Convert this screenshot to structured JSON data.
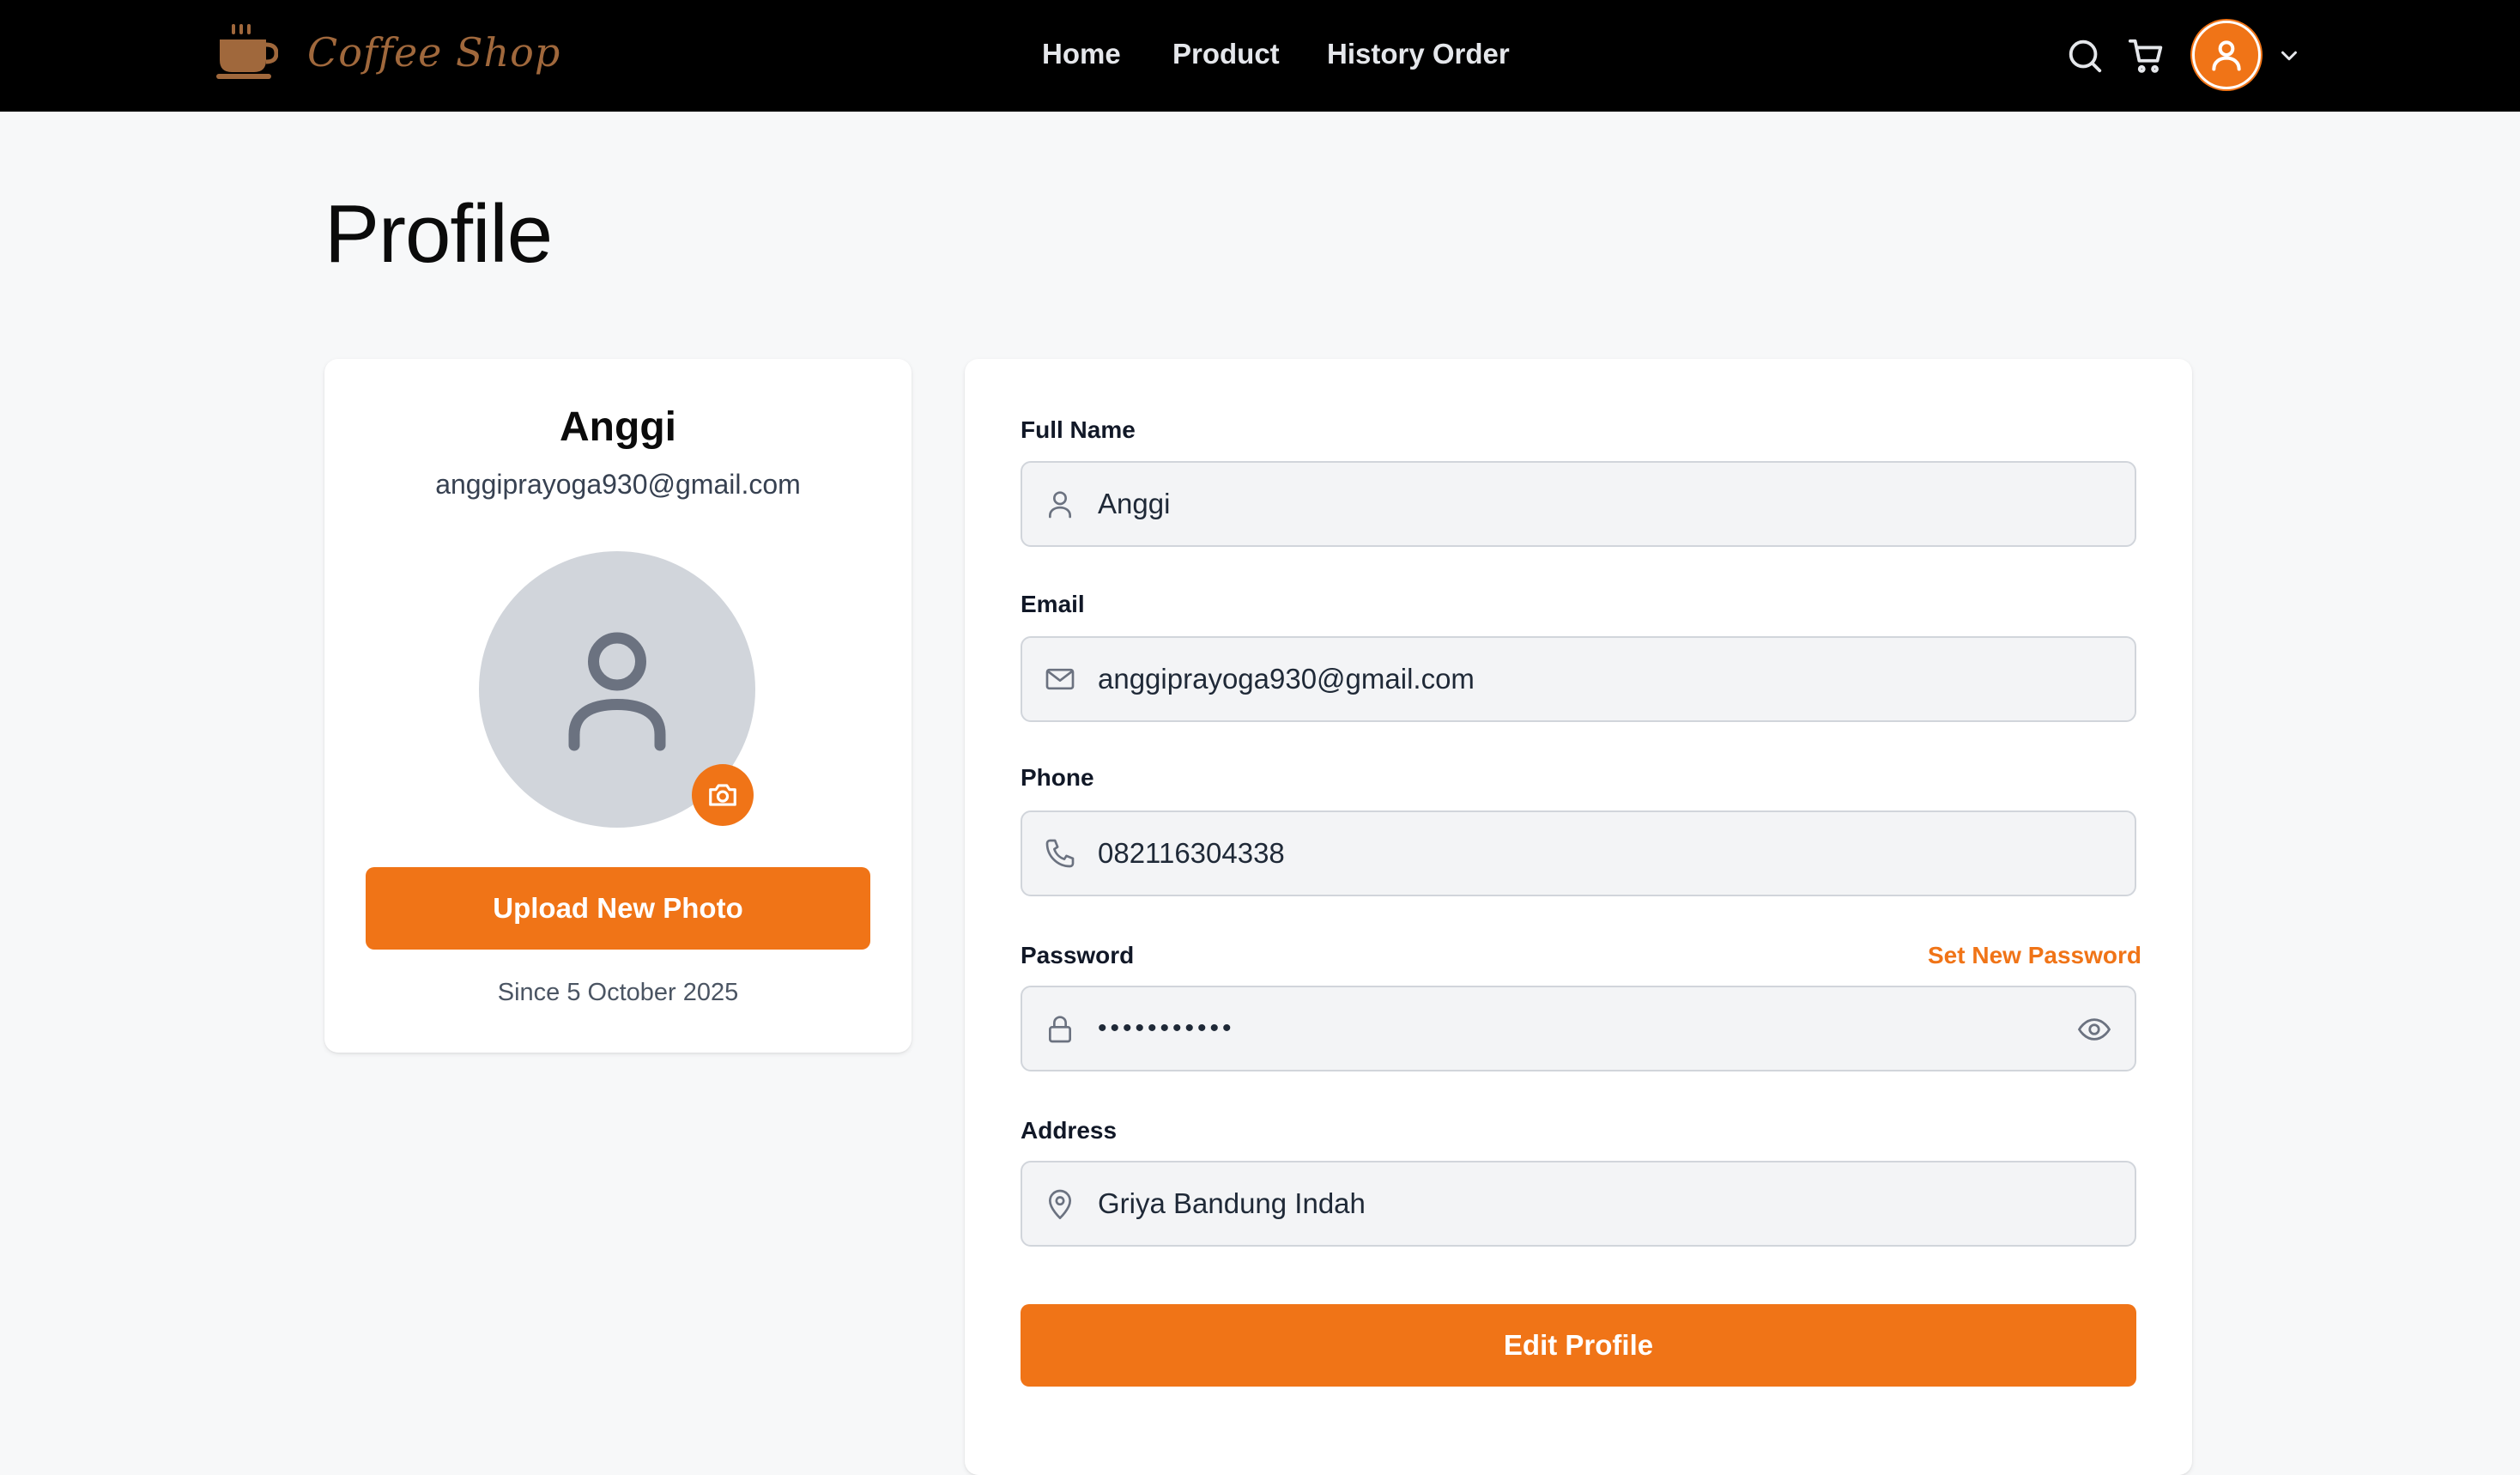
{
  "header": {
    "brand_text": "Coffee Shop",
    "nav": [
      {
        "label": "Home"
      },
      {
        "label": "Product"
      },
      {
        "label": "History Order"
      }
    ],
    "icons": {
      "search": "search-icon",
      "cart": "cart-icon",
      "user": "user-icon",
      "menu": "chevron-down-icon"
    }
  },
  "page": {
    "title": "Profile"
  },
  "profile_card": {
    "name": "Anggi",
    "email": "anggiprayoga930@gmail.com",
    "upload_label": "Upload New Photo",
    "since": "Since 5 October 2025"
  },
  "form": {
    "full_name": {
      "label": "Full Name",
      "value": "Anggi"
    },
    "email": {
      "label": "Email",
      "value": "anggiprayoga930@gmail.com"
    },
    "phone": {
      "label": "Phone",
      "value": "082116304338"
    },
    "password": {
      "label": "Password",
      "value": "•••••••••••",
      "set_new_label": "Set New Password"
    },
    "address": {
      "label": "Address",
      "value": "Griya Bandung Indah"
    },
    "submit_label": "Edit Profile"
  },
  "colors": {
    "accent": "#f07417",
    "header_bg": "#000000",
    "brand": "#a0683c"
  }
}
